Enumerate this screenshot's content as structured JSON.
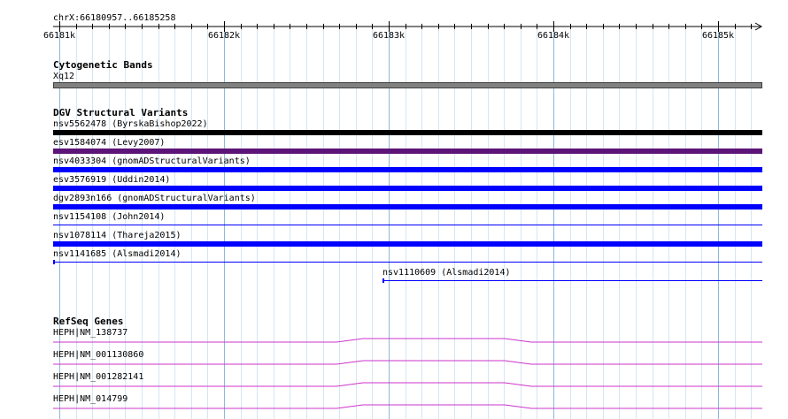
{
  "ruler": {
    "location": "chrX:66180957..66185258",
    "ticks": [
      "66181k",
      "66182k",
      "66183k",
      "66184k",
      "66185k"
    ]
  },
  "cytoband": {
    "title": "Cytogenetic Bands",
    "band": "Xq12",
    "color": "#808080"
  },
  "dgv": {
    "title": "DGV Structural Variants",
    "features": [
      {
        "label": "nsv5562478 (ByrskaBishop2022)",
        "color": "#000000",
        "style": "thick"
      },
      {
        "label": "esv1584074 (Levy2007)",
        "color": "#5c1478",
        "style": "thick"
      },
      {
        "label": "nsv4033304 (gnomADStructuralVariants)",
        "color": "#0000ff",
        "style": "thick"
      },
      {
        "label": "esv3576919 (Uddin2014)",
        "color": "#0000ff",
        "style": "thick"
      },
      {
        "label": "dgv2893n166 (gnomADStructuralVariants)",
        "color": "#0000ff",
        "style": "thick"
      },
      {
        "label": "nsv1154108 (John2014)",
        "color": "#0000ff",
        "style": "thin"
      },
      {
        "label": "nsv1078114 (Thareja2015)",
        "color": "#0000ff",
        "style": "thick"
      },
      {
        "label": "nsv1141685 (Alsmadi2014)",
        "color": "#0000ff",
        "style": "thin"
      },
      {
        "label": "nsv1110609 (Alsmadi2014)",
        "color": "#0000ff",
        "style": "thin"
      }
    ]
  },
  "refseq": {
    "title": "RefSeq Genes",
    "genes": [
      {
        "label": "HEPH|NM_138737"
      },
      {
        "label": "HEPH|NM_001130860"
      },
      {
        "label": "HEPH|NM_001282141"
      },
      {
        "label": "HEPH|NM_014799"
      }
    ],
    "color": "#cc33cc"
  }
}
